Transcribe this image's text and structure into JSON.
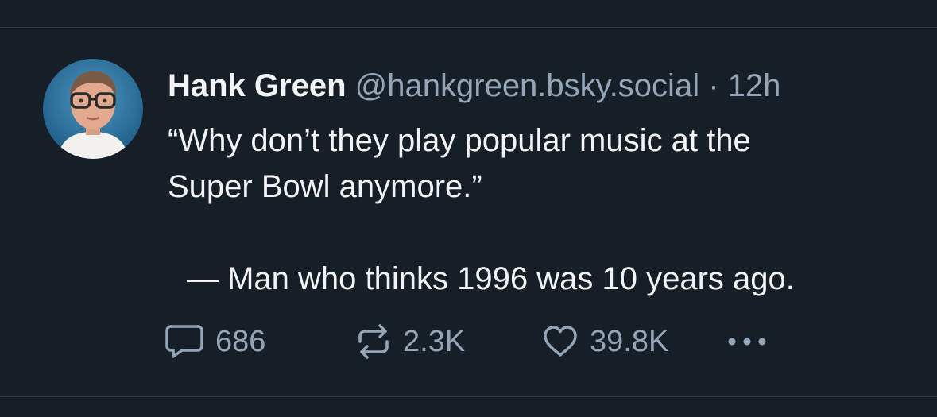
{
  "post": {
    "author": {
      "display_name": "Hank Green",
      "handle": "@hankgreen.bsky.social",
      "avatar_icon": "avatar-photo-icon"
    },
    "separator": "·",
    "timestamp": "12h",
    "text_lines": [
      "“Why don’t they play popular music at the",
      "Super Bowl anymore.”"
    ],
    "attribution": "— Man who thinks 1996 was 10 years ago.",
    "actions": {
      "reply": {
        "icon": "reply-bubble-icon",
        "count": "686"
      },
      "repost": {
        "icon": "repost-arrows-icon",
        "count": "2.3K"
      },
      "like": {
        "icon": "heart-icon",
        "count": "39.8K"
      },
      "more": {
        "icon": "more-dots-icon"
      }
    }
  },
  "colors": {
    "background": "#161e27",
    "primary_text": "#f1f3f5",
    "secondary_text": "#93a5b7",
    "divider": "#2c3744"
  }
}
